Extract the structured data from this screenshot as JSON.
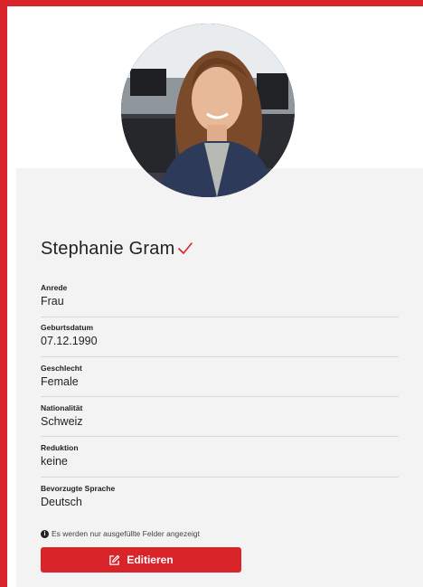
{
  "profile": {
    "name": "Stephanie Gram",
    "verified": true
  },
  "fields": [
    {
      "label": "Anrede",
      "value": "Frau"
    },
    {
      "label": "Geburtsdatum",
      "value": "07.12.1990"
    },
    {
      "label": "Geschlecht",
      "value": "Female"
    },
    {
      "label": "Nationalität",
      "value": "Schweiz"
    },
    {
      "label": "Reduktion",
      "value": "keine"
    },
    {
      "label": "Bevorzugte Sprache",
      "value": "Deutsch"
    }
  ],
  "info_text": "Es werden nur ausgefüllte Felder angezeigt",
  "edit_button_label": "Editieren",
  "colors": {
    "accent": "#d9252a",
    "card_background": "#f3f3f3",
    "text": "#222222",
    "divider": "#d9d9d9"
  },
  "icons": {
    "verified": "check-icon",
    "info": "info-circle-icon",
    "edit": "edit-icon"
  }
}
